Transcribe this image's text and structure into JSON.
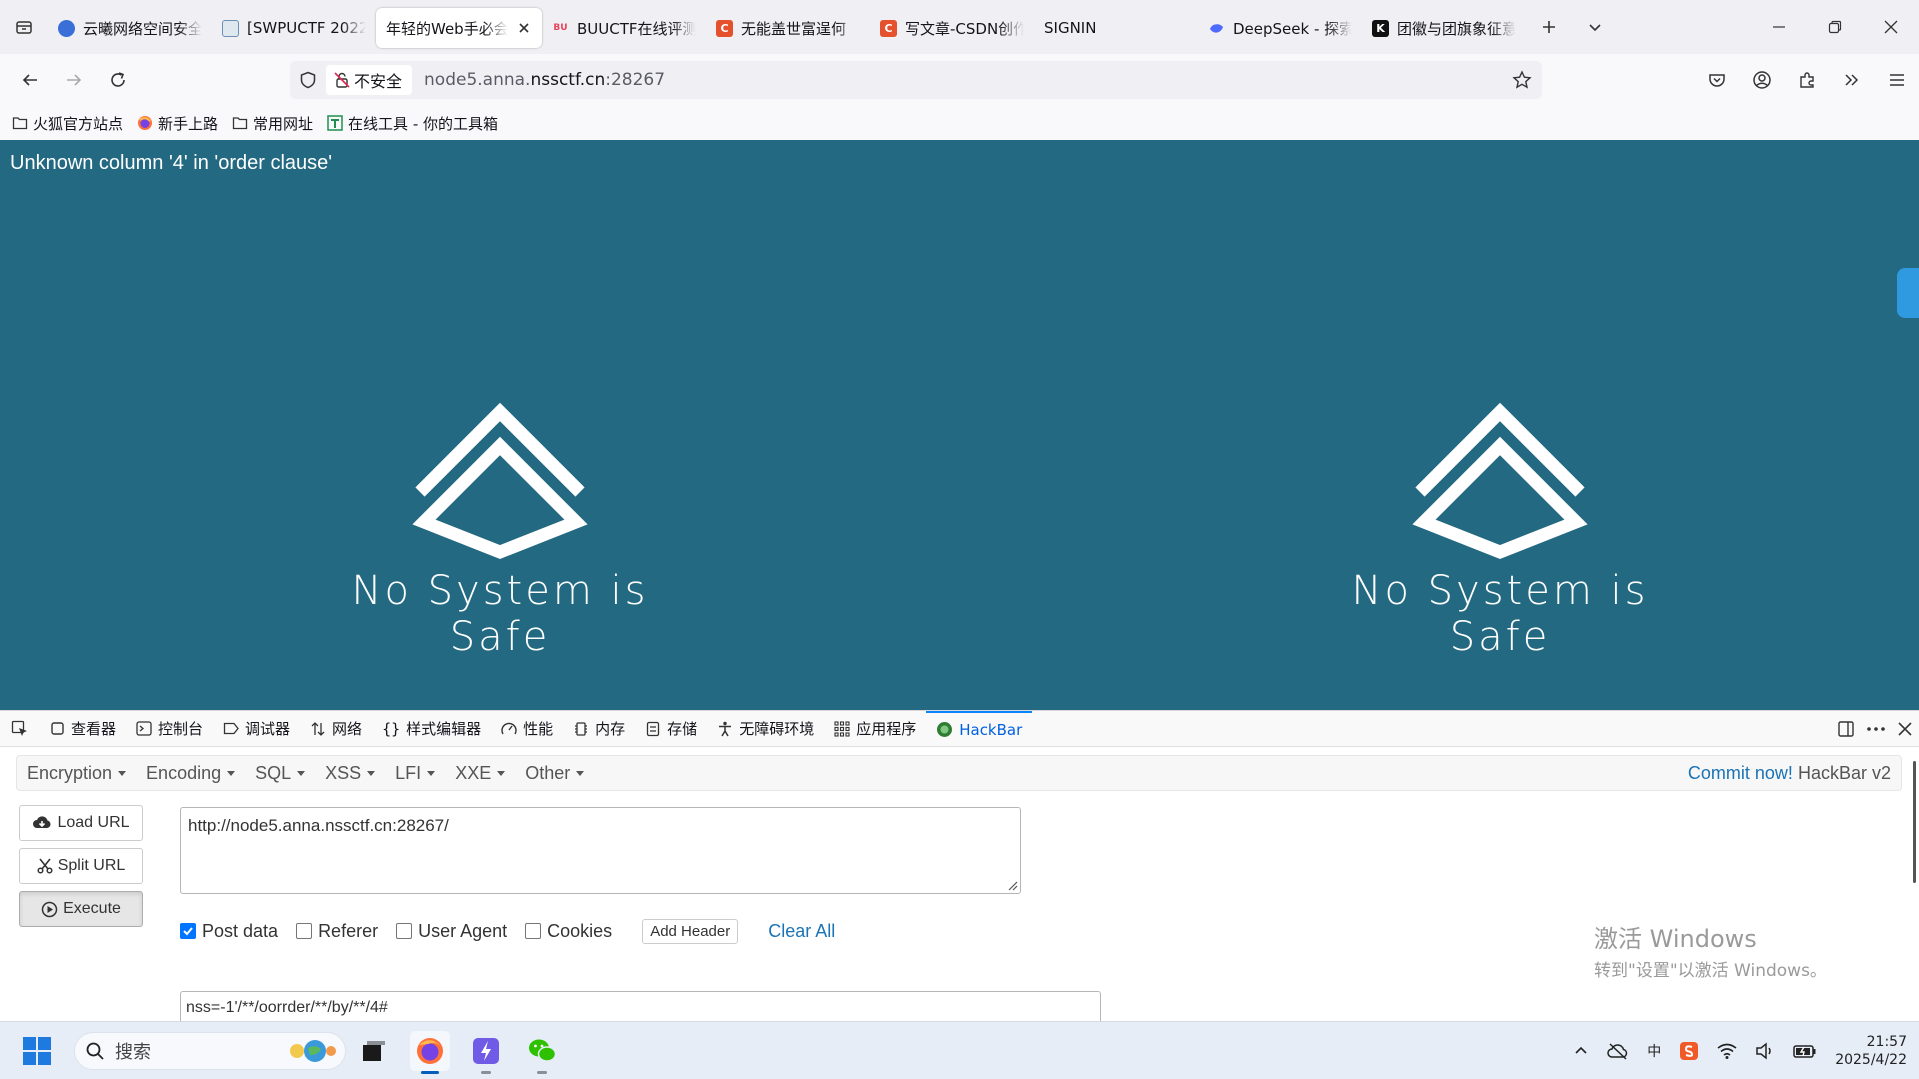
{
  "tabs": [
    {
      "title": "云曦网络空间安全",
      "fav_color": "#3a6fd8",
      "active": false
    },
    {
      "title": "[SWPUCTF 2022",
      "fav_color": "#6c8fb3",
      "active": false
    },
    {
      "title": "年轻的Web手必会",
      "fav_color": "",
      "active": true
    },
    {
      "title": "BUUCTF在线评测",
      "fav_color": "#e8455a",
      "active": false
    },
    {
      "title": "无能盖世富逞何",
      "fav_color": "#e5512c",
      "active": false
    },
    {
      "title": "写文章-CSDN创作",
      "fav_color": "#e5512c",
      "active": false
    },
    {
      "title": "SIGNIN",
      "fav_color": "",
      "active": false
    },
    {
      "title": "DeepSeek - 探索",
      "fav_color": "#4d6bfe",
      "active": false
    },
    {
      "title": "团徽与团旗象征意",
      "fav_color": "#111111",
      "active": false
    }
  ],
  "tab_fav_letters": {
    "csdn": "C",
    "k": "K"
  },
  "nav": {
    "insecure_label": "不安全",
    "url_prefix": "node5.anna.",
    "url_domain": "nssctf.cn",
    "url_port": ":28267"
  },
  "bookmarks": [
    {
      "label": "火狐官方站点",
      "icon": "folder-icon"
    },
    {
      "label": "新手上路",
      "icon": "firefox-icon"
    },
    {
      "label": "常用网址",
      "icon": "folder-icon"
    },
    {
      "label": "在线工具 - 你的工具箱",
      "icon": "tool-icon"
    }
  ],
  "page": {
    "error_text": "Unknown column '4' in 'order clause'",
    "motto": "No System is Safe",
    "bg_color": "#236981"
  },
  "devtools": {
    "tabs": [
      {
        "label": "查看器",
        "icon": "inspector-icon"
      },
      {
        "label": "控制台",
        "icon": "console-icon"
      },
      {
        "label": "调试器",
        "icon": "debugger-icon"
      },
      {
        "label": "网络",
        "icon": "network-icon"
      },
      {
        "label": "样式编辑器",
        "icon": "style-editor-icon"
      },
      {
        "label": "性能",
        "icon": "performance-icon"
      },
      {
        "label": "内存",
        "icon": "memory-icon"
      },
      {
        "label": "存储",
        "icon": "storage-icon"
      },
      {
        "label": "无障碍环境",
        "icon": "accessibility-icon"
      },
      {
        "label": "应用程序",
        "icon": "application-icon"
      },
      {
        "label": "HackBar",
        "icon": "hackbar-icon"
      }
    ],
    "active_tab": "HackBar"
  },
  "hackbar": {
    "menus": [
      "Encryption",
      "Encoding",
      "SQL",
      "XSS",
      "LFI",
      "XXE",
      "Other"
    ],
    "commit_link": "Commit now!",
    "commit_version": "HackBar v2",
    "load_url": "Load URL",
    "split_url": "Split URL",
    "execute": "Execute",
    "url_value": "http://node5.anna.nssctf.cn:28267/",
    "options": [
      {
        "label": "Post data",
        "checked": true
      },
      {
        "label": "Referer",
        "checked": false
      },
      {
        "label": "User Agent",
        "checked": false
      },
      {
        "label": "Cookies",
        "checked": false
      }
    ],
    "add_header": "Add Header",
    "clear_all": "Clear All",
    "post_value": "nss=-1'/**/oorrder/**/by/**/4#"
  },
  "watermark": {
    "line1": "激活 Windows",
    "line2": "转到\"设置\"以激活 Windows。"
  },
  "taskbar": {
    "search_placeholder": "搜索",
    "ime_label": "中",
    "time": "21:57",
    "date": "2025/4/22"
  }
}
